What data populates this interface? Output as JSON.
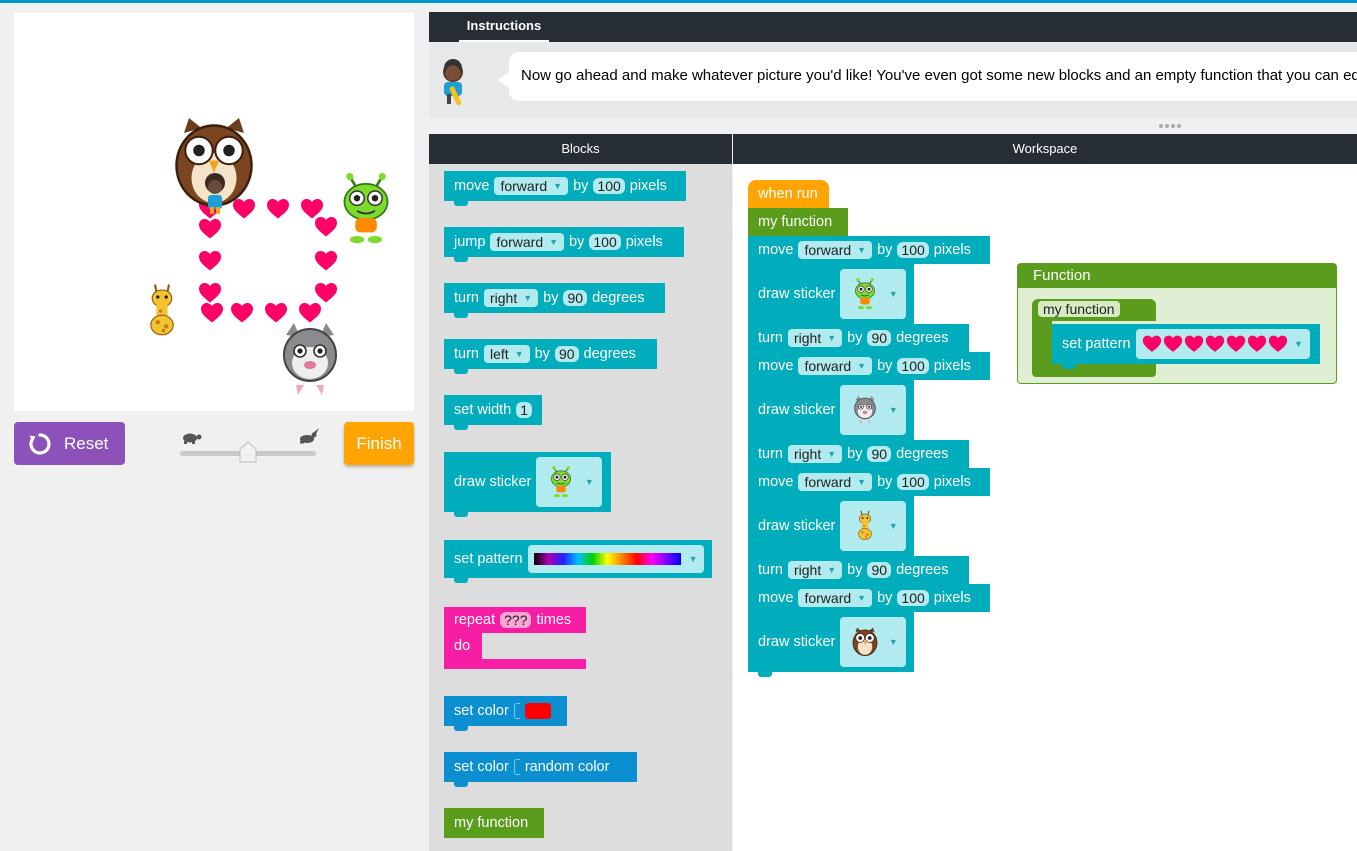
{
  "instructions": {
    "tab_label": "Instructions",
    "text": "Now go ahead and make whatever picture you'd like! You've even got some new blocks and an empty function that you can edit."
  },
  "controls": {
    "reset_label": "Reset",
    "finish_label": "Finish",
    "speed_level": 0.5
  },
  "headers": {
    "blocks": "Blocks",
    "workspace": "Workspace"
  },
  "toolbox": {
    "move": {
      "label": "move",
      "dir": "forward",
      "by": "by",
      "value": "100",
      "unit": "pixels"
    },
    "jump": {
      "label": "jump",
      "dir": "forward",
      "by": "by",
      "value": "100",
      "unit": "pixels"
    },
    "turn_right": {
      "label": "turn",
      "dir": "right",
      "by": "by",
      "value": "90",
      "unit": "degrees"
    },
    "turn_left": {
      "label": "turn",
      "dir": "left",
      "by": "by",
      "value": "90",
      "unit": "degrees"
    },
    "set_width": {
      "label": "set width",
      "value": "1"
    },
    "draw_sticker": {
      "label": "draw sticker",
      "sticker": "alien-icon"
    },
    "set_pattern": {
      "label": "set pattern",
      "pattern": "rainbow"
    },
    "repeat": {
      "label": "repeat",
      "value": "???",
      "times": "times",
      "do": "do"
    },
    "set_color": {
      "label": "set color",
      "color": "#ff0000"
    },
    "set_color_random": {
      "label": "set color",
      "value": "random color"
    },
    "my_function": {
      "label": "my function"
    }
  },
  "workspace": {
    "when_run": "when run",
    "call_function": "my function",
    "program": [
      {
        "type": "move",
        "label": "move",
        "dir": "forward",
        "by": "by",
        "value": "100",
        "unit": "pixels"
      },
      {
        "type": "sticker",
        "label": "draw sticker",
        "sticker": "alien-icon"
      },
      {
        "type": "turn",
        "label": "turn",
        "dir": "right",
        "by": "by",
        "value": "90",
        "unit": "degrees"
      },
      {
        "type": "move",
        "label": "move",
        "dir": "forward",
        "by": "by",
        "value": "100",
        "unit": "pixels"
      },
      {
        "type": "sticker",
        "label": "draw sticker",
        "sticker": "bat-icon"
      },
      {
        "type": "turn",
        "label": "turn",
        "dir": "right",
        "by": "by",
        "value": "90",
        "unit": "degrees"
      },
      {
        "type": "move",
        "label": "move",
        "dir": "forward",
        "by": "by",
        "value": "100",
        "unit": "pixels"
      },
      {
        "type": "sticker",
        "label": "draw sticker",
        "sticker": "giraffe-icon"
      },
      {
        "type": "turn",
        "label": "turn",
        "dir": "right",
        "by": "by",
        "value": "90",
        "unit": "degrees"
      },
      {
        "type": "move",
        "label": "move",
        "dir": "forward",
        "by": "by",
        "value": "100",
        "unit": "pixels"
      },
      {
        "type": "sticker",
        "label": "draw sticker",
        "sticker": "owl-icon"
      }
    ],
    "function_def": {
      "header": "Function",
      "name": "my function",
      "inner_label": "set pattern",
      "pattern": "hearts"
    }
  },
  "colors": {
    "cyan_block": "#00adbc",
    "blue_block": "#0c8fd0",
    "green_block": "#5a9d1c",
    "orange_block": "#ffa400",
    "pink_block": "#f51ea4",
    "heart": "#ff0066",
    "reset": "#8c52ba",
    "finish": "#ffa400",
    "header_dark": "#272d35"
  }
}
